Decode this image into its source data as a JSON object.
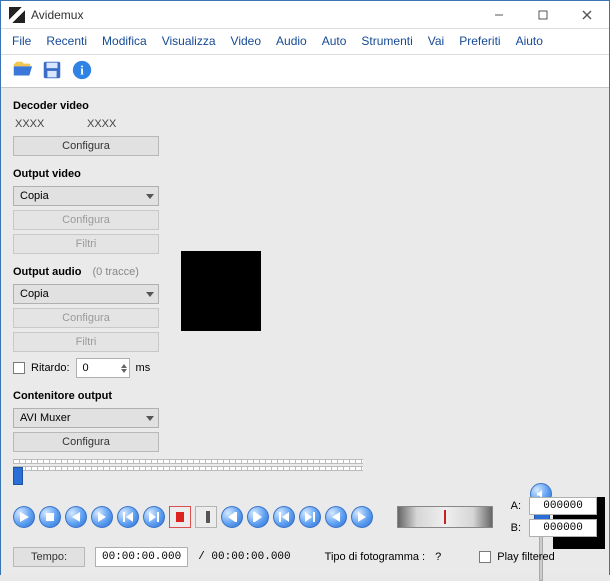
{
  "window": {
    "title": "Avidemux"
  },
  "menu": {
    "items": [
      "File",
      "Recenti",
      "Modifica",
      "Visualizza",
      "Video",
      "Audio",
      "Auto",
      "Strumenti",
      "Vai",
      "Preferiti",
      "Aiuto"
    ]
  },
  "decoder": {
    "header": "Decoder video",
    "val1": "XXXX",
    "val2": "XXXX",
    "configure": "Configura"
  },
  "output_video": {
    "header": "Output video",
    "codec": "Copia",
    "configure": "Configura",
    "filters": "Filtri"
  },
  "output_audio": {
    "header": "Output audio",
    "tracks_note": "(0 tracce)",
    "codec": "Copia",
    "configure": "Configura",
    "filters": "Filtri",
    "delay_label": "Ritardo:",
    "delay_value": "0",
    "delay_unit": "ms"
  },
  "container": {
    "header": "Contenitore output",
    "muxer": "AVI Muxer",
    "configure": "Configura"
  },
  "markers": {
    "A_label": "A:",
    "A_value": "000000",
    "B_label": "B:",
    "B_value": "000000"
  },
  "time": {
    "button": "Tempo:",
    "current": "00:00:00.000",
    "total": "/ 00:00:00.000",
    "frame_type_label": "Tipo di fotogramma :",
    "frame_type_value": "?"
  },
  "play_filtered": {
    "label": "Play filtered"
  }
}
